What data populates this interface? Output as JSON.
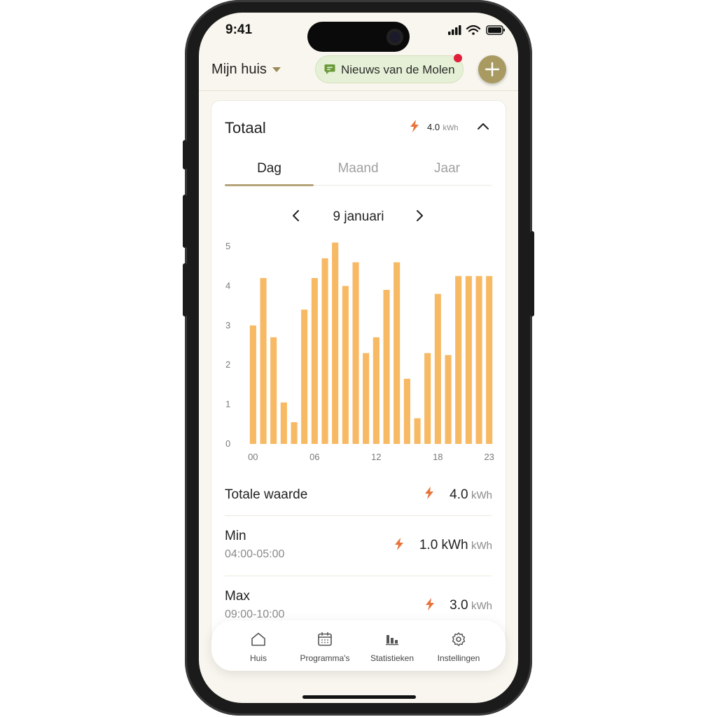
{
  "status": {
    "time": "9:41"
  },
  "header": {
    "home_label": "Mijn huis",
    "news_label": "Nieuws van de Molen"
  },
  "card": {
    "title": "Totaal",
    "total_value": "4.0",
    "total_unit": "kWh",
    "tabs": [
      {
        "label": "Dag",
        "active": true
      },
      {
        "label": "Maand",
        "active": false
      },
      {
        "label": "Jaar",
        "active": false
      }
    ],
    "date_label": "9 januari"
  },
  "chart_data": {
    "type": "bar",
    "x": [
      "00",
      "01",
      "02",
      "03",
      "04",
      "05",
      "06",
      "07",
      "08",
      "09",
      "10",
      "11",
      "12",
      "13",
      "14",
      "15",
      "16",
      "17",
      "18",
      "19",
      "20",
      "21",
      "22",
      "23"
    ],
    "values": [
      3.0,
      4.2,
      2.7,
      1.05,
      0.55,
      3.4,
      4.2,
      4.7,
      5.1,
      4.0,
      4.6,
      2.3,
      2.7,
      3.9,
      4.6,
      1.65,
      0.65,
      2.3,
      3.8,
      2.25,
      4.25,
      4.25,
      4.25,
      4.25
    ],
    "x_tick_labels": [
      "00",
      "06",
      "12",
      "18",
      "23"
    ],
    "y_tick_labels": [
      "0",
      "1",
      "2",
      "3",
      "4",
      "5"
    ],
    "ylim": [
      0,
      5
    ],
    "bar_color": "#f7b964"
  },
  "stats": {
    "total": {
      "label": "Totale waarde",
      "value": "4.0",
      "unit": "kWh"
    },
    "min": {
      "label": "Min",
      "range": "04:00-05:00",
      "value": "1.0 kWh",
      "unit": "kWh"
    },
    "max": {
      "label": "Max",
      "range": "09:00-10:00",
      "value": "3.0",
      "unit": "kWh"
    }
  },
  "nav": {
    "items": [
      {
        "label": "Huis",
        "icon": "home-icon"
      },
      {
        "label": "Programma's",
        "icon": "calendar-icon"
      },
      {
        "label": "Statistieken",
        "icon": "stats-icon"
      },
      {
        "label": "Instellingen",
        "icon": "gear-icon"
      }
    ]
  },
  "colors": {
    "accent": "#a99a62",
    "bolt": "#e8743b",
    "bars": "#f7b964",
    "news_bg": "#e6f0d6",
    "notification": "#e0203a"
  }
}
